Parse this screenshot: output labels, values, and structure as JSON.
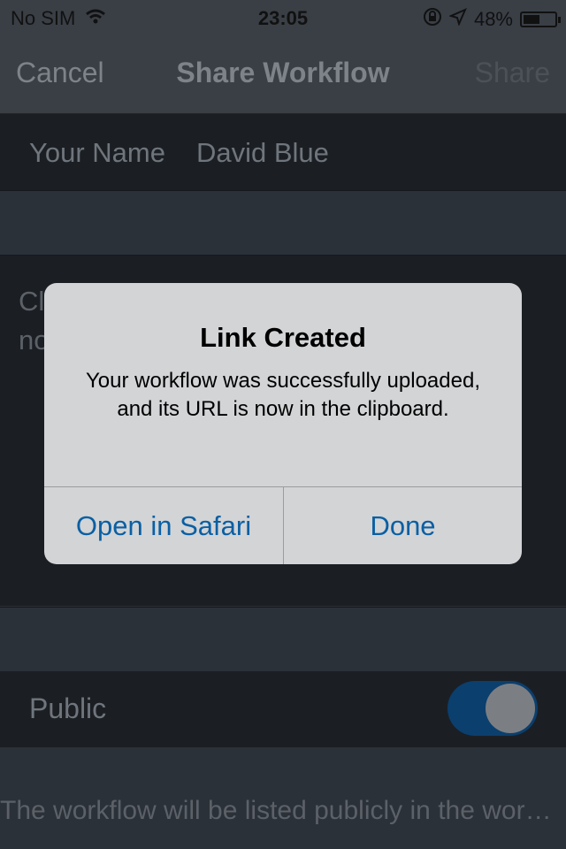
{
  "status_bar": {
    "carrier": "No SIM",
    "time": "23:05",
    "battery_percent": "48%",
    "battery_level": 0.48,
    "icons": [
      "wifi-icon",
      "rotation-lock-icon",
      "location-arrow-icon",
      "battery-icon"
    ]
  },
  "nav": {
    "cancel_label": "Cancel",
    "title": "Share Workflow",
    "share_label": "Share"
  },
  "form": {
    "name_label": "Your Name",
    "name_value": "David Blue",
    "description_partial": "Cl\nno",
    "public_label": "Public",
    "public_enabled": true,
    "public_note": "The workflow will be listed publicly in the wor…"
  },
  "alert": {
    "title": "Link Created",
    "message": "Your workflow was successfully uploaded, and its URL is now in the clipboard.",
    "button_left": "Open in Safari",
    "button_right": "Done"
  },
  "colors": {
    "accent": "#0a5fa3",
    "toggle_on": "#0b3f6e",
    "alert_bg": "#d2d4d6"
  }
}
